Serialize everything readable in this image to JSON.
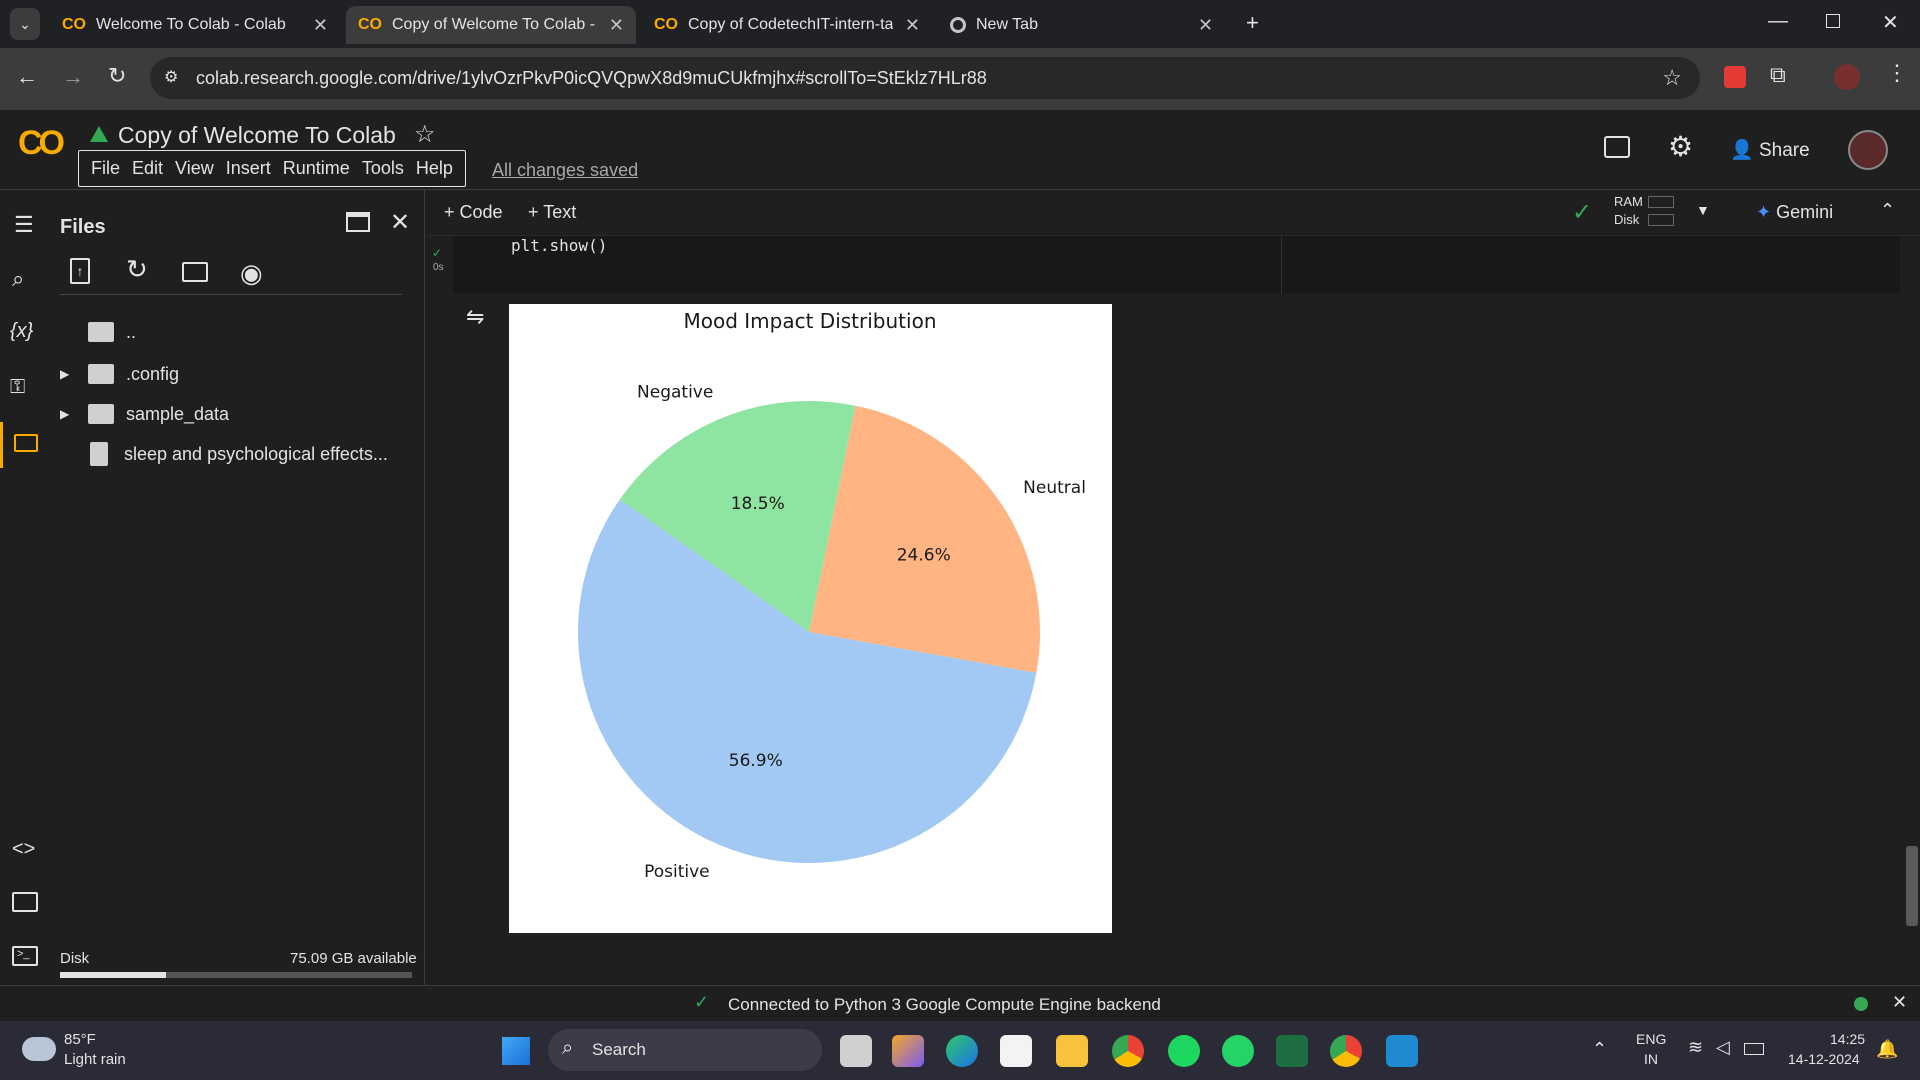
{
  "browser": {
    "tabs": [
      {
        "title": "Welcome To Colab - Colab",
        "active": false
      },
      {
        "title": "Copy of Welcome To Colab - Colab",
        "active": true
      },
      {
        "title": "Copy of CodetechIT-intern-task",
        "active": false
      },
      {
        "title": "New Tab",
        "active": false
      }
    ],
    "url": "colab.research.google.com/drive/1ylvOzrPkvP0icQVQpwX8d9muCUkfmjhx#scrollTo=StEklz7HLr88"
  },
  "colab": {
    "logo": "CO",
    "notebook_title": "Copy of Welcome To Colab",
    "menu": [
      "File",
      "Edit",
      "View",
      "Insert",
      "Runtime",
      "Tools",
      "Help"
    ],
    "save_status": "All changes saved",
    "share_label": "Share"
  },
  "files_panel": {
    "title": "Files",
    "items": [
      {
        "name": "..",
        "type": "folder-up"
      },
      {
        "name": ".config",
        "type": "folder"
      },
      {
        "name": "sample_data",
        "type": "folder"
      },
      {
        "name": "sleep and psychological effects...",
        "type": "file"
      }
    ],
    "disk_label": "Disk",
    "disk_available": "75.09 GB available",
    "disk_used_fraction": 0.3
  },
  "toolbar": {
    "add_code": "+ Code",
    "add_text": "+ Text",
    "ram_label": "RAM",
    "disk_label": "Disk",
    "gemini_label": "Gemini"
  },
  "cell": {
    "code": "plt.show()",
    "exec_time": "0s"
  },
  "status_bar": {
    "message": "Connected to Python 3 Google Compute Engine backend"
  },
  "taskbar": {
    "weather_temp": "85°F",
    "weather_desc": "Light rain",
    "search_placeholder": "Search",
    "lang_line1": "ENG",
    "lang_line2": "IN",
    "time": "14:25",
    "date": "14-12-2024"
  },
  "chart_data": {
    "type": "pie",
    "title": "Mood Impact Distribution",
    "categories": [
      "Positive",
      "Neutral",
      "Negative"
    ],
    "values": [
      56.9,
      24.6,
      18.5
    ],
    "labels_pct": [
      "56.9%",
      "24.6%",
      "18.5%"
    ],
    "colors": [
      "#a1c9f4",
      "#ffb482",
      "#8de5a1"
    ]
  }
}
